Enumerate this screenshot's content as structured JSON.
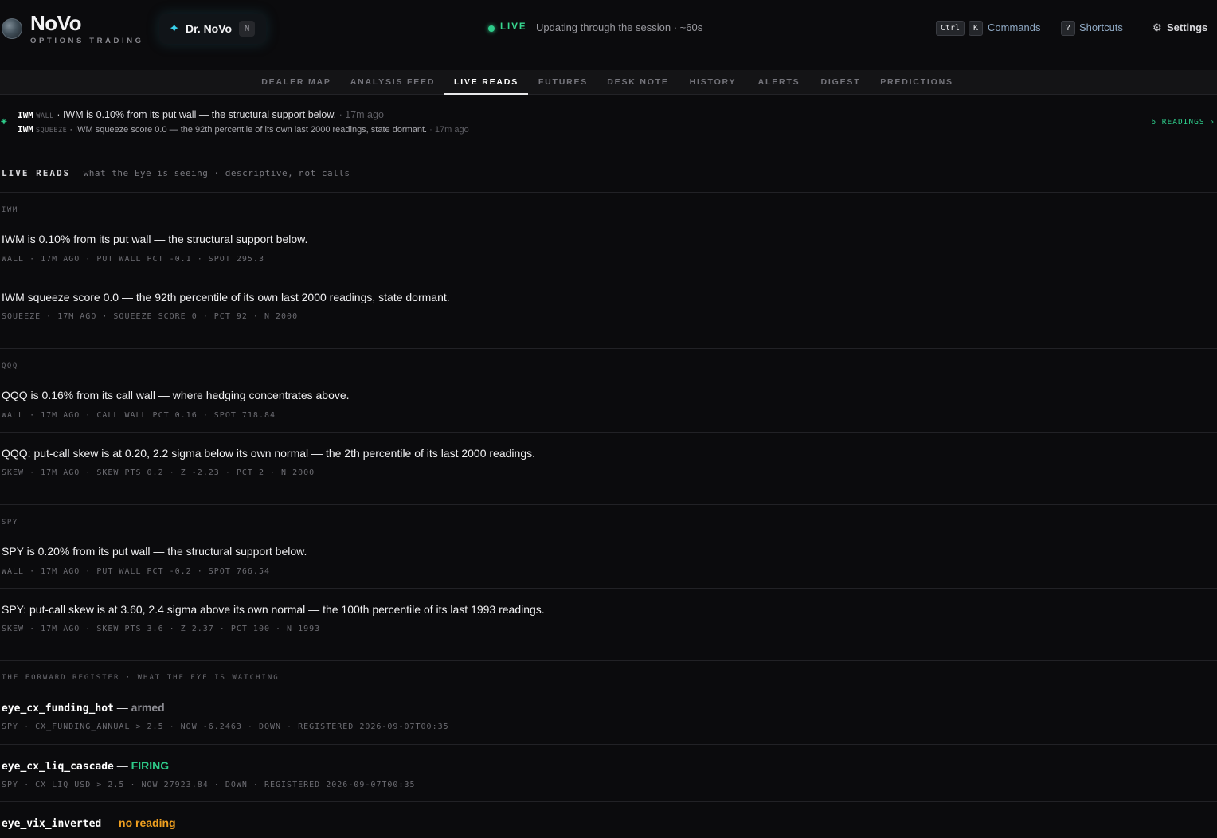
{
  "brand": {
    "name": "NoVo",
    "subtitle": "OPTIONS TRADING"
  },
  "assistant": {
    "label": "Dr. NoVo",
    "badge": "N",
    "icon": "sparkle-icon"
  },
  "status": {
    "live_label": "LIVE",
    "description": "Updating through the session · ~60s",
    "color": "#2ecc8a"
  },
  "header_actions": {
    "commands_kbd_1": "Ctrl",
    "commands_kbd_2": "K",
    "commands_label": "Commands",
    "shortcuts_kbd": "?",
    "shortcuts_label": "Shortcuts",
    "settings_icon": "⚙",
    "settings_label": "Settings"
  },
  "tabs": [
    {
      "label": "DEALER MAP"
    },
    {
      "label": "ANALYSIS FEED"
    },
    {
      "label": "LIVE READS"
    },
    {
      "label": "FUTURES"
    },
    {
      "label": "DESK NOTE"
    },
    {
      "label": "HISTORY"
    },
    {
      "label": "ALERTS"
    },
    {
      "label": "DIGEST"
    },
    {
      "label": "PREDICTIONS"
    }
  ],
  "active_tab": "LIVE READS",
  "ticker": {
    "items": [
      {
        "symbol": "IWM",
        "kind": "WALL",
        "text": " · IWM is 0.10% from its put wall — the structural support below.",
        "ago": " · 17m ago"
      },
      {
        "symbol": "IWM",
        "kind": "SQUEEZE",
        "text": " · IWM squeeze score 0.0 — the 92th percentile of its own last 2000 readings, state dormant.",
        "ago": " · 17m ago"
      }
    ],
    "readings_link": "6 READINGS ›"
  },
  "section": {
    "title": "LIVE READS",
    "subtitle": "what the Eye is seeing · descriptive, not calls"
  },
  "groups": [
    {
      "symbol": "IWM",
      "reads": [
        {
          "text": "IWM is 0.10% from its put wall — the structural support below.",
          "meta": "WALL · 17M AGO · PUT WALL PCT -0.1 · SPOT 295.3"
        },
        {
          "text": "IWM squeeze score 0.0 — the 92th percentile of its own last 2000 readings, state dormant.",
          "meta": "SQUEEZE · 17M AGO · SQUEEZE SCORE 0 · PCT 92 · N 2000"
        }
      ]
    },
    {
      "symbol": "QQQ",
      "reads": [
        {
          "text": "QQQ is 0.16% from its call wall — where hedging concentrates above.",
          "meta": "WALL · 17M AGO · CALL WALL PCT 0.16 · SPOT 718.84"
        },
        {
          "text": "QQQ: put-call skew is at 0.20, 2.2 sigma below its own normal — the 2th percentile of its last 2000 readings.",
          "meta": "SKEW · 17M AGO · SKEW PTS 0.2 · Z -2.23 · PCT 2 · N 2000"
        }
      ]
    },
    {
      "symbol": "SPY",
      "reads": [
        {
          "text": "SPY is 0.20% from its put wall — the structural support below.",
          "meta": "WALL · 17M AGO · PUT WALL PCT -0.2 · SPOT 766.54"
        },
        {
          "text": "SPY: put-call skew is at 3.60, 2.4 sigma above its own normal — the 100th percentile of its last 1993 readings.",
          "meta": "SKEW · 17M AGO · SKEW PTS 3.6 · Z 2.37 · PCT 100 · N 1993"
        }
      ]
    }
  ],
  "register": {
    "title": "THE FORWARD REGISTER · WHAT THE EYE IS WATCHING",
    "items": [
      {
        "name": "eye_cx_funding_hot",
        "dash": " — ",
        "state": "armed",
        "meta": "SPY · CX_FUNDING_ANNUAL > 2.5 · NOW -6.2463 · DOWN · REGISTERED 2026-09-07T00:35"
      },
      {
        "name": "eye_cx_liq_cascade",
        "dash": " — ",
        "state": "FIRING",
        "meta": "SPY · CX_LIQ_USD > 2.5 · NOW 27923.84 · DOWN · REGISTERED 2026-09-07T00:35"
      },
      {
        "name": "eye_vix_inverted",
        "dash": " — ",
        "state": "no reading"
      }
    ]
  }
}
